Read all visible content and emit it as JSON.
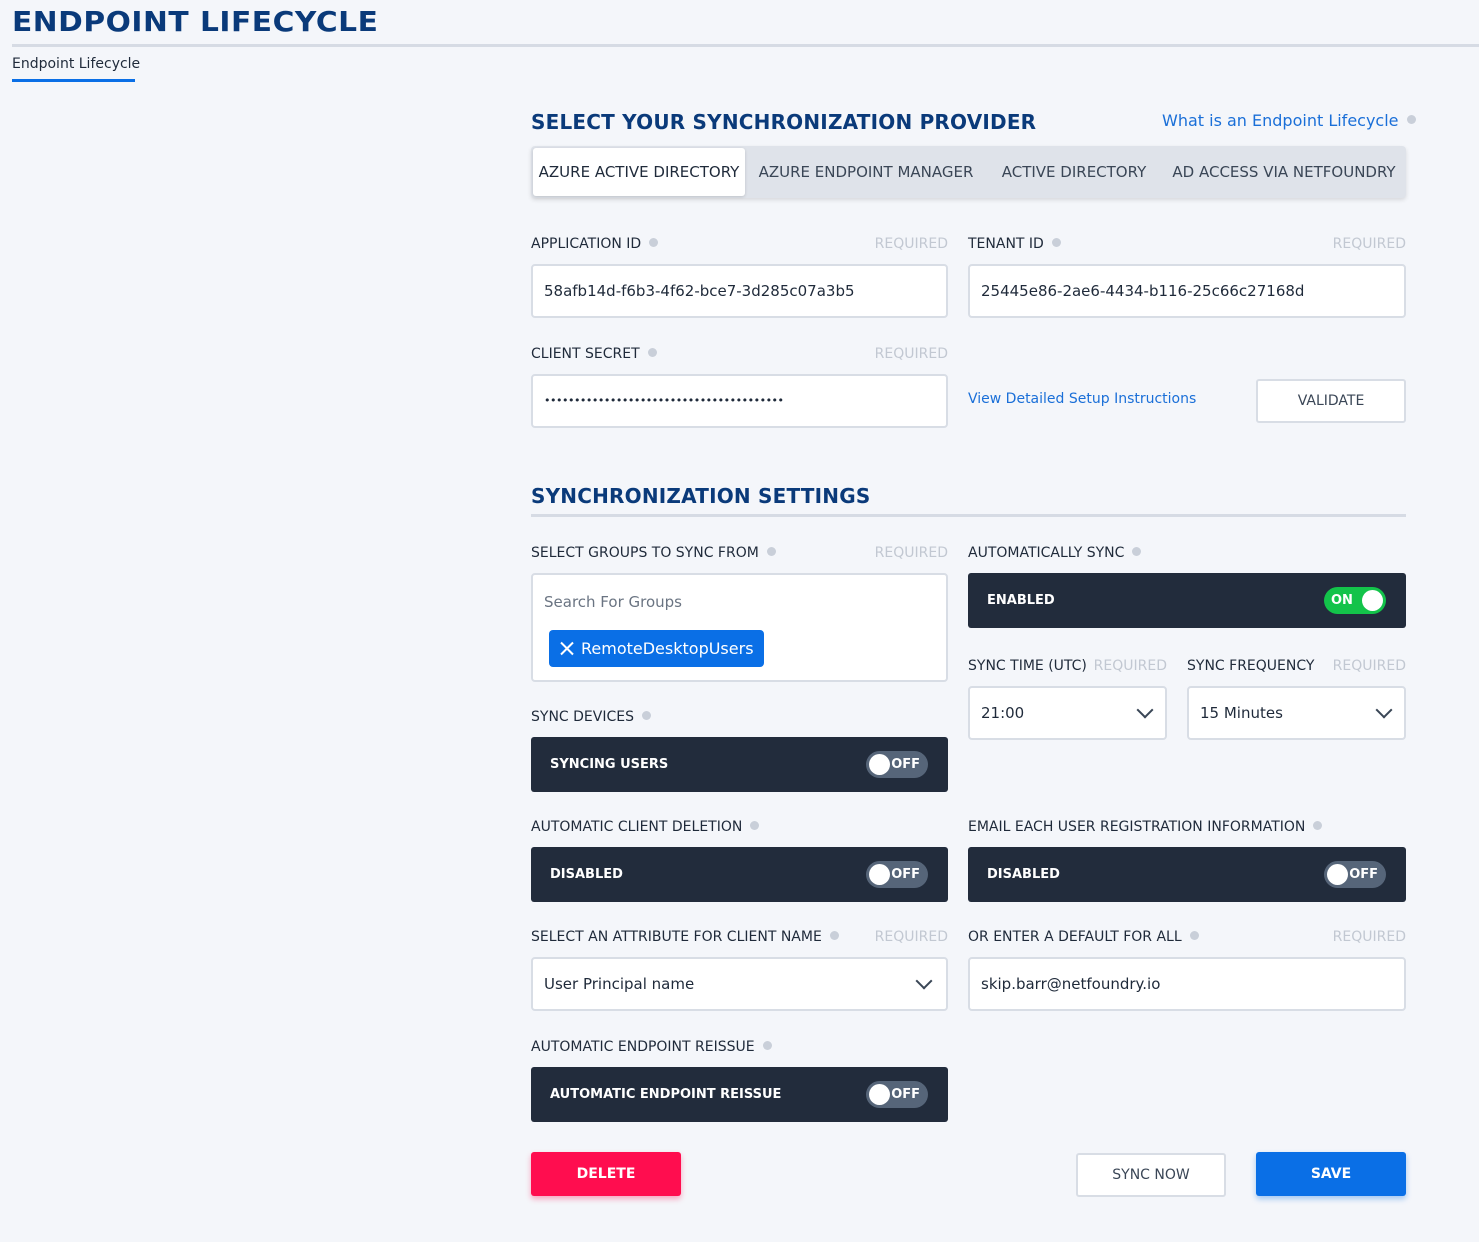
{
  "page": {
    "title": "ENDPOINT LIFECYCLE",
    "subtab": "Endpoint Lifecycle"
  },
  "provider": {
    "section_title": "SELECT YOUR SYNCHRONIZATION PROVIDER",
    "help_link": "What is an Endpoint Lifecycle",
    "tabs": [
      {
        "label": "AZURE ACTIVE DIRECTORY",
        "active": true
      },
      {
        "label": "AZURE ENDPOINT MANAGER",
        "active": false
      },
      {
        "label": "ACTIVE DIRECTORY",
        "active": false
      },
      {
        "label": "AD ACCESS VIA NETFOUNDRY",
        "active": false
      }
    ]
  },
  "credentials": {
    "application_id": {
      "label": "APPLICATION ID",
      "required": "REQUIRED",
      "value": "58afb14d-f6b3-4f62-bce7-3d285c07a3b5"
    },
    "tenant_id": {
      "label": "TENANT ID",
      "required": "REQUIRED",
      "value": "25445e86-2ae6-4434-b116-25c66c27168d"
    },
    "client_secret": {
      "label": "CLIENT SECRET",
      "required": "REQUIRED",
      "value": "••••••••••••••••••••••••••••••••••••••••"
    },
    "setup_link": "View Detailed Setup Instructions",
    "validate_label": "VALIDATE"
  },
  "sync": {
    "section_title": "SYNCHRONIZATION SETTINGS",
    "groups": {
      "label": "SELECT GROUPS TO SYNC FROM",
      "required": "REQUIRED",
      "placeholder": "Search For Groups",
      "chips": [
        "RemoteDesktopUsers"
      ]
    },
    "auto_sync": {
      "label": "AUTOMATICALLY SYNC",
      "bar_label": "ENABLED",
      "state": "ON"
    },
    "sync_time": {
      "label": "SYNC TIME (UTC)",
      "required": "REQUIRED",
      "value": "21:00"
    },
    "sync_frequency": {
      "label": "SYNC FREQUENCY",
      "required": "REQUIRED",
      "value": "15 Minutes"
    },
    "sync_devices": {
      "label": "SYNC DEVICES",
      "bar_label": "SYNCING USERS",
      "state": "OFF"
    },
    "auto_client_deletion": {
      "label": "AUTOMATIC CLIENT DELETION",
      "bar_label": "DISABLED",
      "state": "OFF"
    },
    "email_registration": {
      "label": "EMAIL EACH USER REGISTRATION INFORMATION",
      "bar_label": "DISABLED",
      "state": "OFF"
    },
    "client_name_attribute": {
      "label": "SELECT AN ATTRIBUTE FOR CLIENT NAME",
      "required": "REQUIRED",
      "value": "User Principal name"
    },
    "default_for_all": {
      "label": "OR ENTER A DEFAULT FOR ALL",
      "required": "REQUIRED",
      "value": "skip.barr@netfoundry.io"
    },
    "auto_reissue": {
      "label": "AUTOMATIC ENDPOINT REISSUE",
      "bar_label": "AUTOMATIC ENDPOINT REISSUE",
      "state": "OFF"
    }
  },
  "actions": {
    "delete_label": "DELETE",
    "sync_now_label": "SYNC NOW",
    "save_label": "SAVE"
  },
  "colors": {
    "brand_navy": "#0a3a7a",
    "primary_blue": "#0a6fe6",
    "danger": "#ff0d4f",
    "toggle_bar": "#222c3c",
    "toggle_on": "#13c34a"
  }
}
